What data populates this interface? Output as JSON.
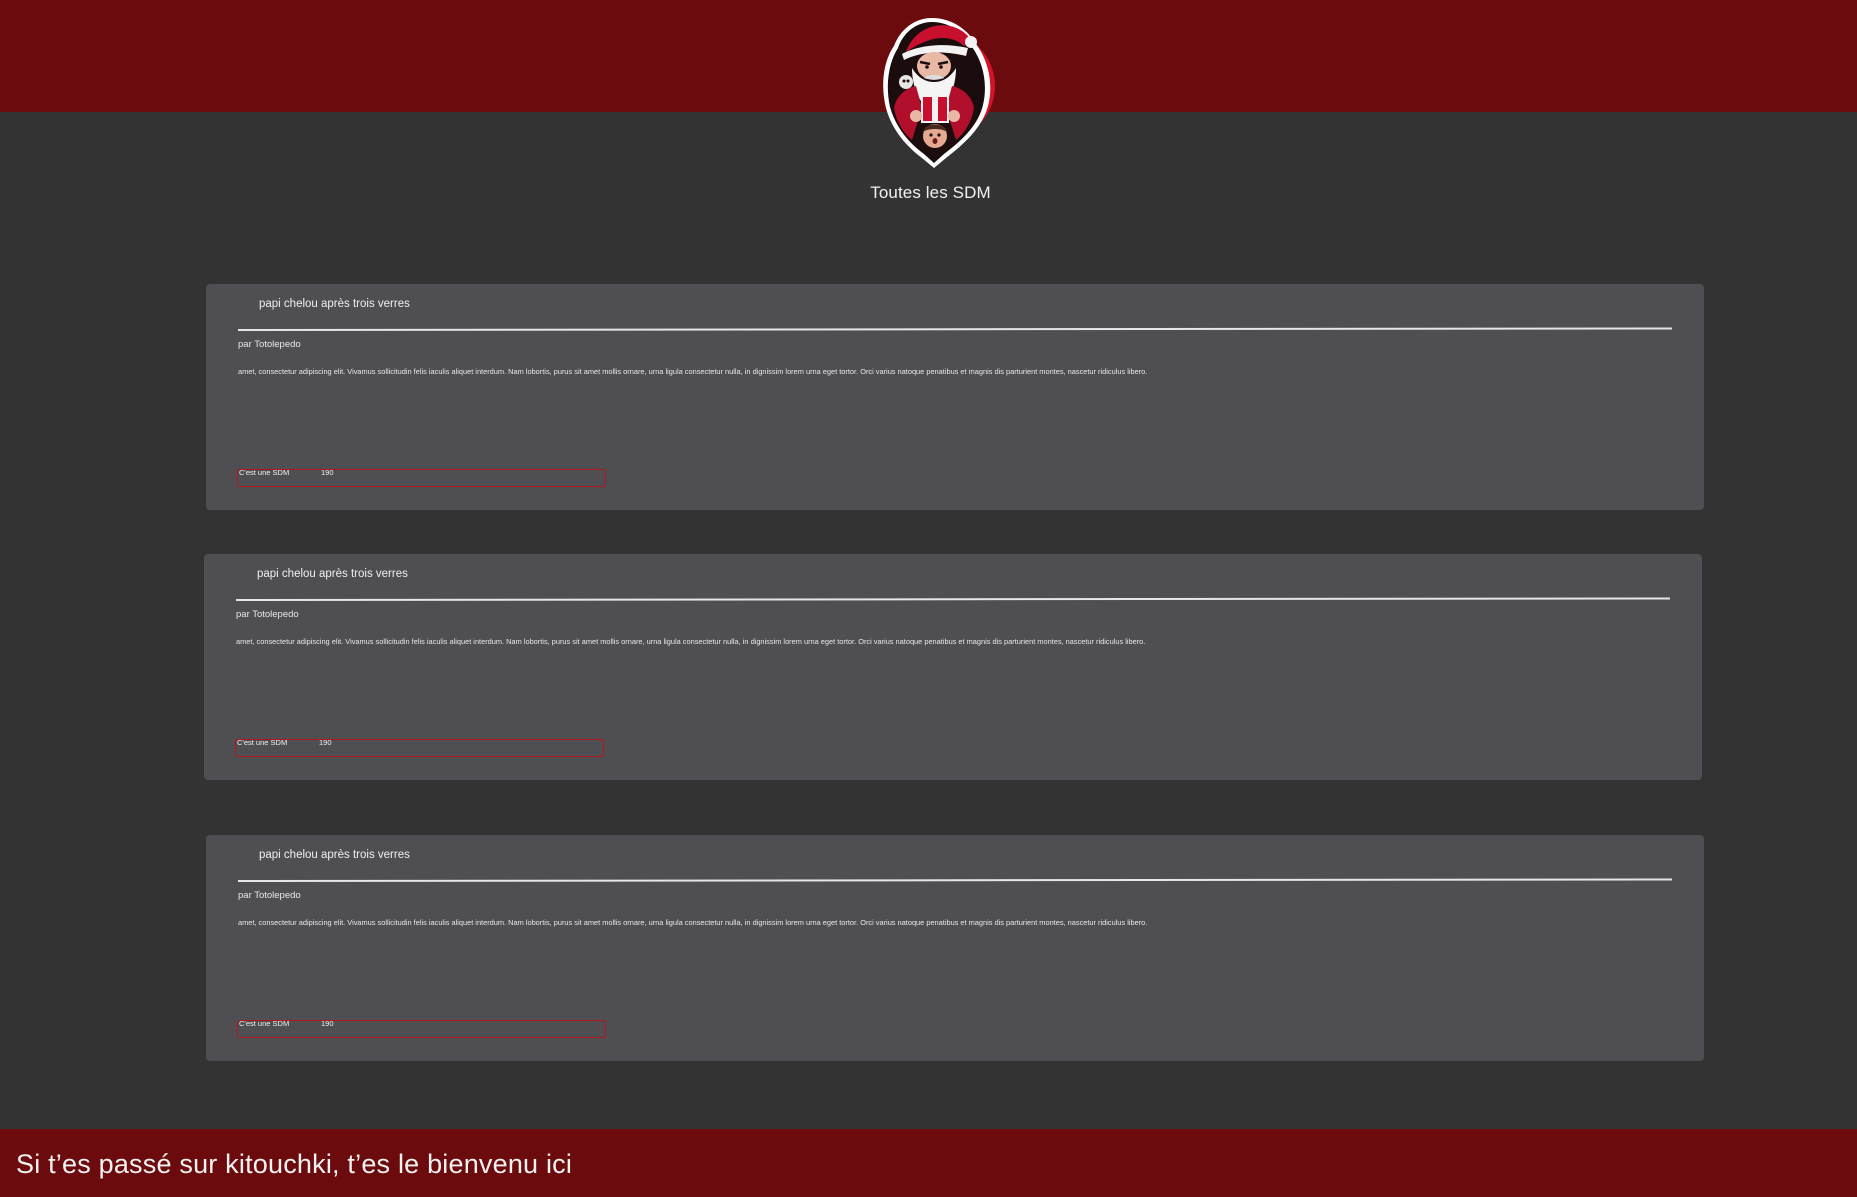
{
  "header": {
    "title": "Toutes les SDM",
    "logo_icon": "santa-claus-mascot-icon"
  },
  "posts": [
    {
      "title": "papi chelou après trois verres",
      "author": "par Totolepedo",
      "body": "amet, consectetur adipiscing elit. Vivamus sollicitudin felis iaculis aliquet interdum. Nam lobortis, purus sit amet mollis ornare, urna ligula consectetur nulla, in dignissim lorem urna eget tortor. Orci varius natoque penatibus et magnis dis parturient montes, nascetur ridiculus libero.",
      "tag_label": "C'est une SDM",
      "count": "190"
    },
    {
      "title": "papi chelou après trois verres",
      "author": "par Totolepedo",
      "body": "amet, consectetur adipiscing elit. Vivamus sollicitudin felis iaculis aliquet interdum. Nam lobortis, purus sit amet mollis ornare, urna ligula consectetur nulla, in dignissim lorem urna eget tortor. Orci varius natoque penatibus et magnis dis parturient montes, nascetur ridiculus libero.",
      "tag_label": "C'est une SDM",
      "count": "190"
    },
    {
      "title": "papi chelou après trois verres",
      "author": "par Totolepedo",
      "body": "amet, consectetur adipiscing elit. Vivamus sollicitudin felis iaculis aliquet interdum. Nam lobortis, purus sit amet mollis ornare, urna ligula consectetur nulla, in dignissim lorem urna eget tortor. Orci varius natoque penatibus et magnis dis parturient montes, nascetur ridiculus libero.",
      "tag_label": "C'est une SDM",
      "count": "190"
    }
  ],
  "footer": {
    "text": "Si t’es passé sur kitouchki, t’es le bienvenu ici"
  },
  "colors": {
    "brand_red": "#6c0b0d",
    "background": "#333333",
    "card": "#4f4e53",
    "accent_border": "#b3161b"
  }
}
